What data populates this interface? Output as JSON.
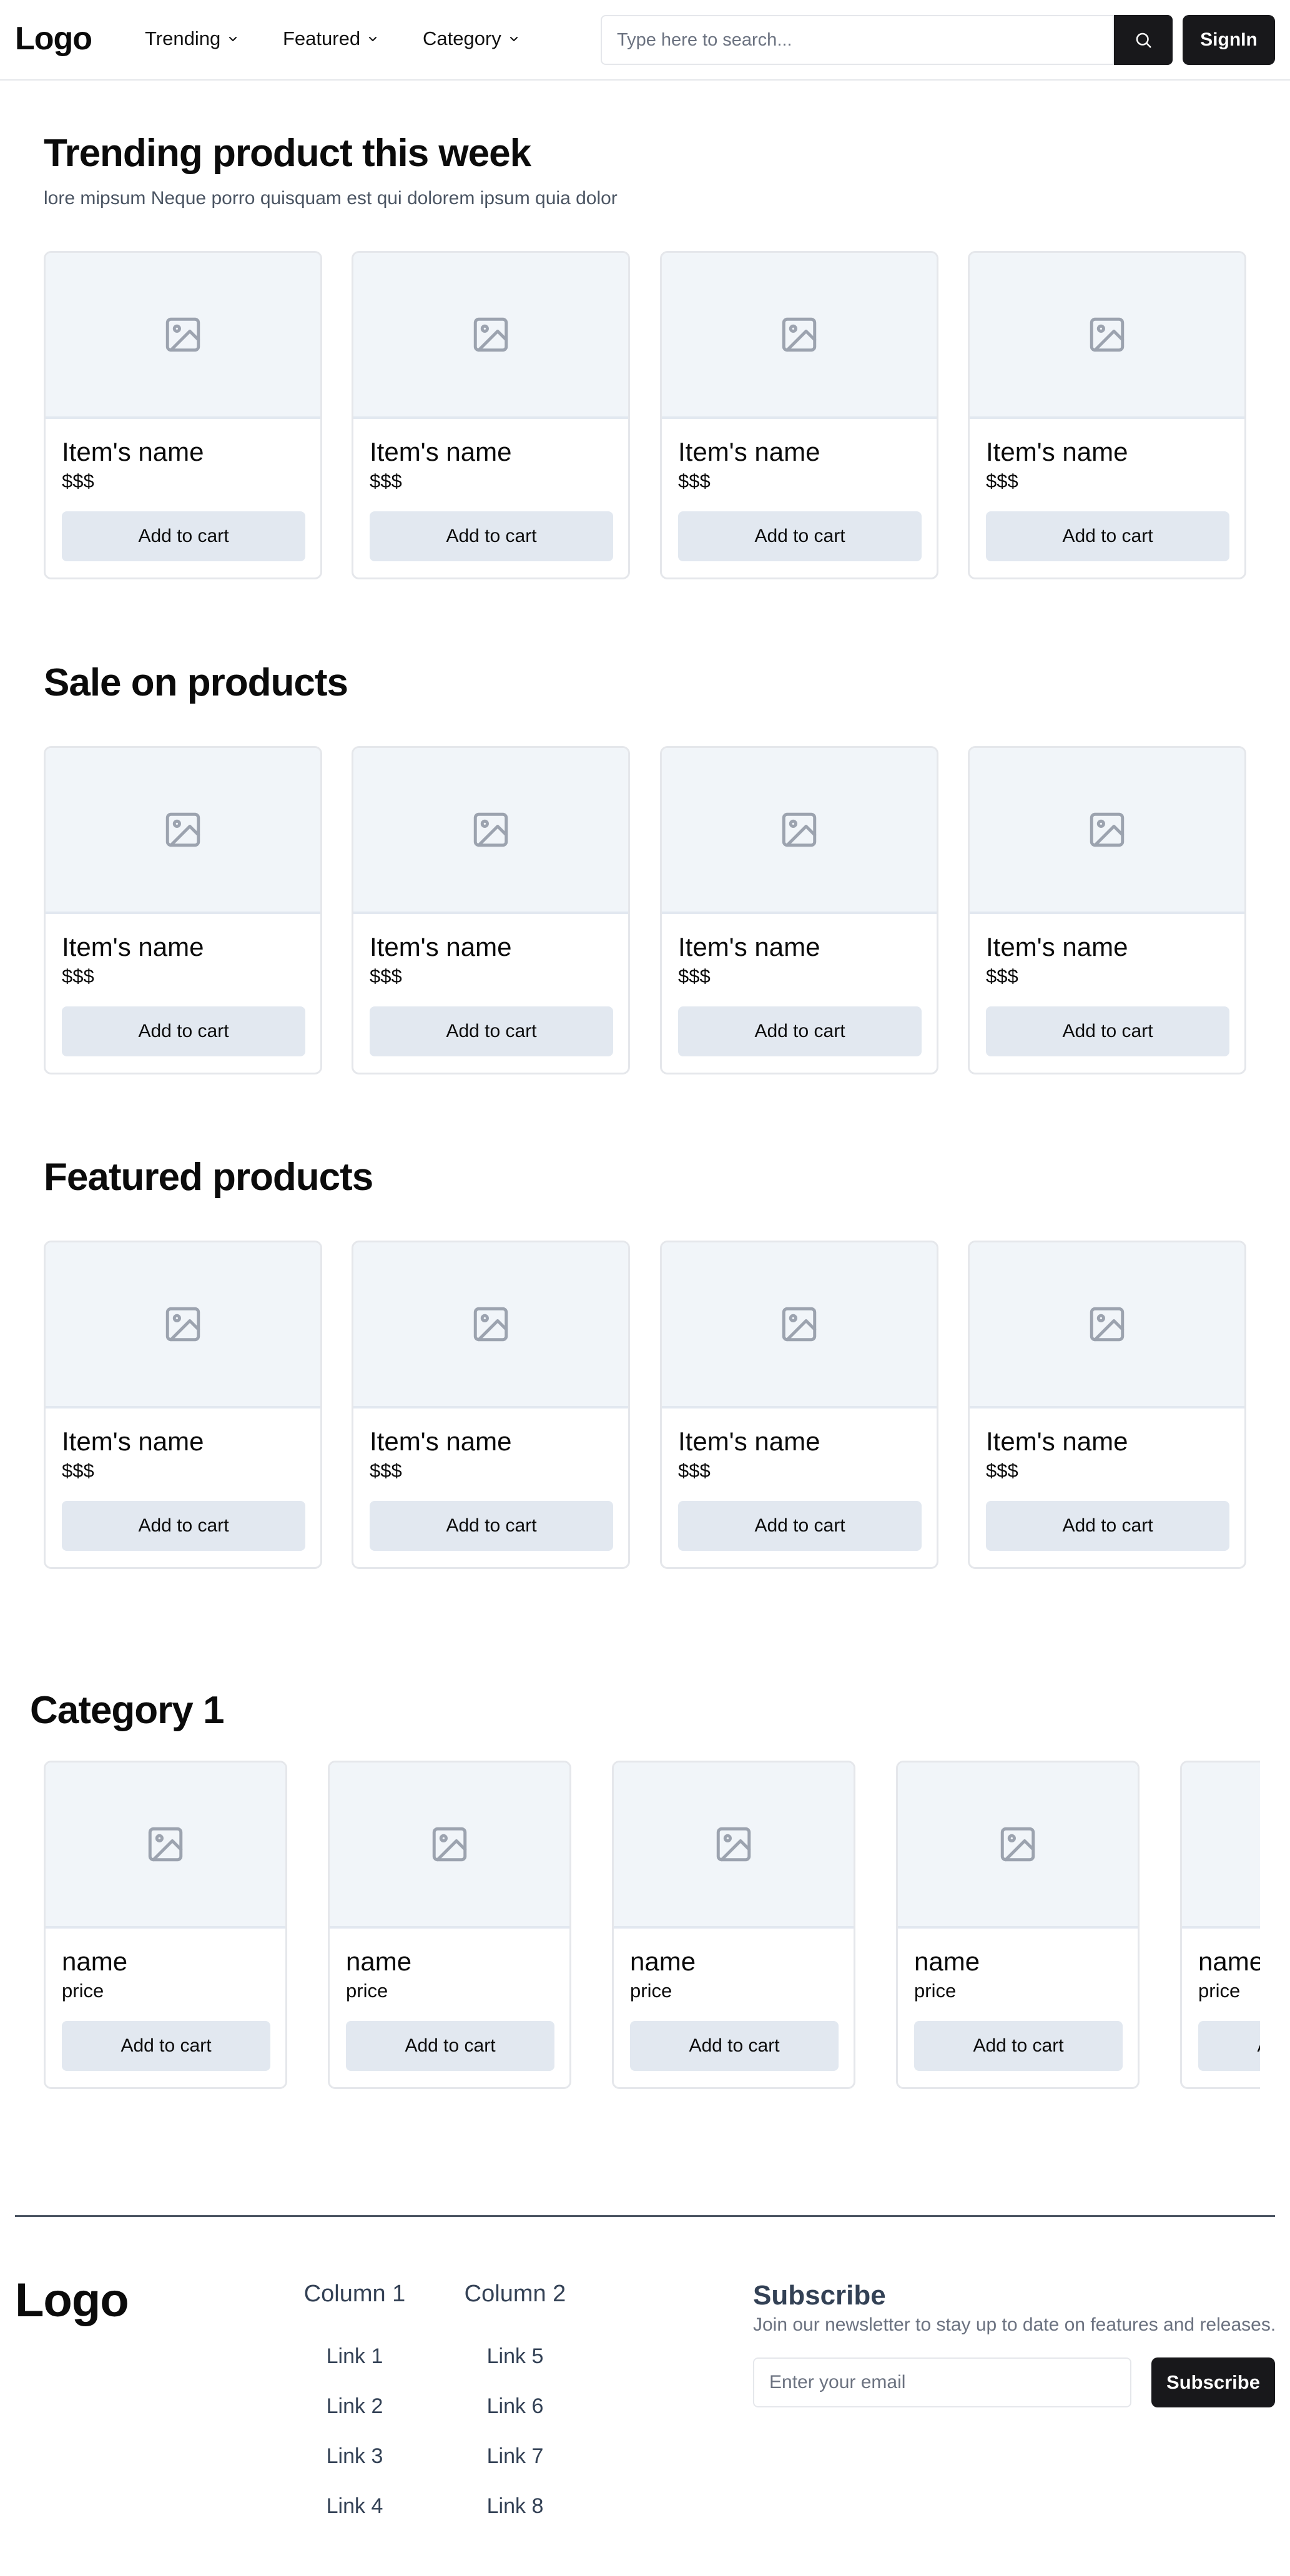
{
  "nav": {
    "logo": "Logo",
    "items": [
      {
        "label": "Trending"
      },
      {
        "label": "Featured"
      },
      {
        "label": "Category"
      }
    ],
    "search_placeholder": "Type here to search...",
    "signin_label": "SignIn"
  },
  "sections": [
    {
      "title": "Trending product this week",
      "subtitle": "lore mipsum Neque porro quisquam est qui dolorem ipsum quia dolor",
      "products": [
        {
          "name": "Item's name",
          "price": "$$$",
          "button": "Add to cart"
        },
        {
          "name": "Item's name",
          "price": "$$$",
          "button": "Add to cart"
        },
        {
          "name": "Item's name",
          "price": "$$$",
          "button": "Add to cart"
        },
        {
          "name": "Item's name",
          "price": "$$$",
          "button": "Add to cart"
        }
      ]
    },
    {
      "title": "Sale on products",
      "products": [
        {
          "name": "Item's name",
          "price": "$$$",
          "button": "Add to cart"
        },
        {
          "name": "Item's name",
          "price": "$$$",
          "button": "Add to cart"
        },
        {
          "name": "Item's name",
          "price": "$$$",
          "button": "Add to cart"
        },
        {
          "name": "Item's name",
          "price": "$$$",
          "button": "Add to cart"
        }
      ]
    },
    {
      "title": "Featured products",
      "products": [
        {
          "name": "Item's name",
          "price": "$$$",
          "button": "Add to cart"
        },
        {
          "name": "Item's name",
          "price": "$$$",
          "button": "Add to cart"
        },
        {
          "name": "Item's name",
          "price": "$$$",
          "button": "Add to cart"
        },
        {
          "name": "Item's name",
          "price": "$$$",
          "button": "Add to cart"
        }
      ]
    }
  ],
  "category": {
    "title": "Category 1",
    "products": [
      {
        "name": "name",
        "price": "price",
        "button": "Add to cart"
      },
      {
        "name": "name",
        "price": "price",
        "button": "Add to cart"
      },
      {
        "name": "name",
        "price": "price",
        "button": "Add to cart"
      },
      {
        "name": "name",
        "price": "price",
        "button": "Add to cart"
      },
      {
        "name": "name",
        "price": "price",
        "button": "Add to cart"
      }
    ]
  },
  "footer": {
    "logo": "Logo",
    "columns": [
      {
        "heading": "Column 1",
        "links": [
          "Link 1",
          "Link 2",
          "Link 3",
          "Link 4"
        ]
      },
      {
        "heading": "Column 2",
        "links": [
          "Link 5",
          "Link 6",
          "Link 7",
          "Link 8"
        ]
      }
    ],
    "subscribe": {
      "title": "Subscribe",
      "description": "Join our newsletter to stay up to date on features and releases.",
      "email_placeholder": "Enter your email",
      "button": "Subscribe"
    }
  },
  "icons": {
    "search": "search-icon",
    "chevron": "chevron-down-icon",
    "image": "image-placeholder-icon"
  },
  "colors": {
    "primary": "#18181b",
    "image_bg": "#f1f5f9",
    "button_bg": "#e2e8f0"
  }
}
